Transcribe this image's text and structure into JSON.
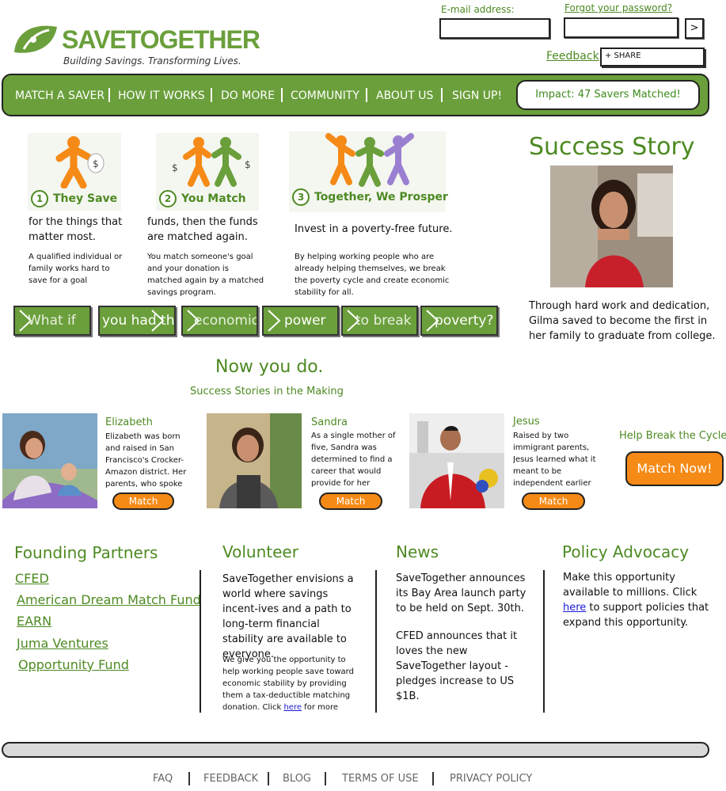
{
  "brand": {
    "name_save": "Save",
    "name_together": "Together",
    "tagline": "Building Savings. Transforming Lives.",
    "accent_color": "#6a9f3b",
    "orange_color": "#f58a16"
  },
  "login": {
    "email_label": "E-mail address:",
    "forgot_label": "Forgot your password?",
    "submit_label": ">",
    "feedback_label": "Feedback",
    "share_label": "+ SHARE"
  },
  "nav": {
    "items": [
      "MATCH A SAVER",
      "HOW IT WORKS",
      "DO MORE",
      "COMMUNITY",
      "ABOUT US",
      "SIGN UP!"
    ],
    "impact": "Impact: 47 Savers Matched!"
  },
  "steps": [
    {
      "num": "1",
      "label": "They Save",
      "head": "for the things that matter most.",
      "body": "A qualified individual or family works hard to save for a goal"
    },
    {
      "num": "2",
      "label": "You Match",
      "head": "funds, then the funds are matched again.",
      "body": "You match someone's goal and your donation is matched again by a matched savings program."
    },
    {
      "num": "3",
      "label": "Together, We Prosper",
      "head": "Invest in a poverty-free future.",
      "body": "By helping working people who are already helping themselves, we break the poverty cycle and create economic stability for all."
    }
  ],
  "arrows": [
    "What if",
    "you had the",
    "economic",
    "power",
    "to break",
    "poverty?"
  ],
  "story": {
    "title": "Success Story",
    "text": "Through hard work and dedication, Gilma saved to become the first in her family to graduate from college."
  },
  "now": {
    "title": "Now you do.",
    "subtitle": "Success Stories in the Making"
  },
  "savers": [
    {
      "name": "Elizabeth",
      "desc": "Elizabeth was born and raised in San Francisco's Crocker-Amazon district. Her parents, who spoke only",
      "button": "Match"
    },
    {
      "name": "Sandra",
      "desc": "As a single mother of five, Sandra was determined to find a career that would provide for her family,",
      "button": "Match"
    },
    {
      "name": "Jesus",
      "desc": "Raised by two immigrant parents, Jesus learned what it meant to be independent earlier",
      "button": "Match"
    }
  ],
  "cycle": {
    "title": "Help Break the Cycle",
    "button": "Match Now!"
  },
  "partners": {
    "title": "Founding Partners",
    "items": [
      "CFED",
      "American Dream Match Fund",
      "EARN",
      "Juma Ventures",
      "Opportunity Fund"
    ]
  },
  "volunteer": {
    "title": "Volunteer",
    "body": "SaveTogether envisions a world where savings incent-ives and a path to long-term financial stability are available to everyone.",
    "small_pre": "We give you the opportunity to help working people save toward economic stability by providing them a tax-deductible matching donation. Click ",
    "small_link": "here",
    "small_post": " for more"
  },
  "news": {
    "title": "News",
    "item1": "SaveTogether announces its Bay Area launch party to be held on Sept. 30th.",
    "item2": "CFED announces that it loves the new SaveTogether layout - pledges increase to US $1B."
  },
  "policy": {
    "title": "Policy Advocacy",
    "pre": "Make this opportunity available to millions. Click ",
    "link": "here",
    "post": " to support policies that expand this opportunity."
  },
  "footer": [
    "FAQ",
    "FEEDBACK",
    "BLOG",
    "TERMS OF USE",
    "PRIVACY POLICY"
  ]
}
